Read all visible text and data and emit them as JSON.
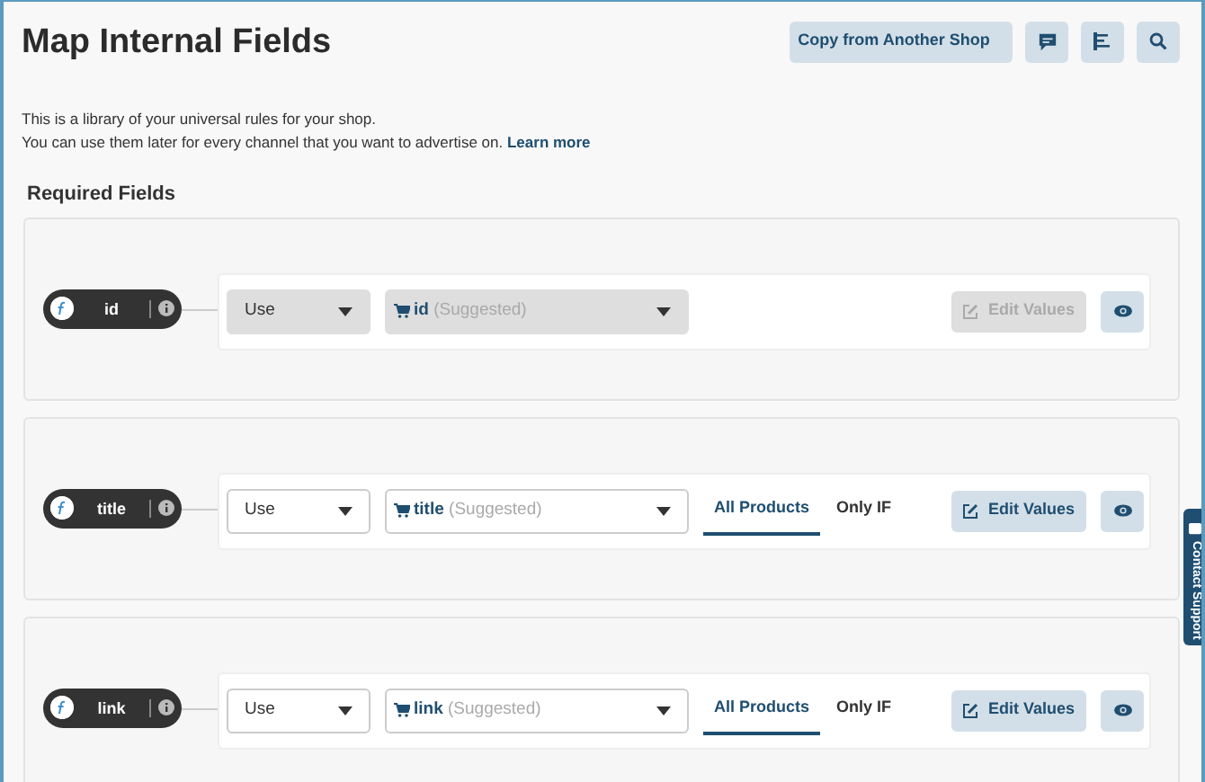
{
  "page": {
    "title": "Map Internal Fields"
  },
  "toolbar": {
    "copy_button": "Copy from Another Shop"
  },
  "intro": {
    "line_1": "This is a library of your universal rules for your shop.",
    "line_2": "You can use them later for every channel that you want to advertise on.",
    "link": "Learn more"
  },
  "section": {
    "title": "Required Fields"
  },
  "fields": [
    {
      "name": "id",
      "disabled": true,
      "mode": "Use",
      "source": "id",
      "source_hint": "(Suggested)",
      "edit_button": "Edit Values"
    },
    {
      "name": "title",
      "disabled": false,
      "mode": "Use",
      "source": "title",
      "source_hint": "(Suggested)",
      "tabs": [
        {
          "label": "All Products",
          "selected": true
        },
        {
          "label": "Only IF",
          "selected": false
        }
      ],
      "edit_button": "Edit Values"
    },
    {
      "name": "link",
      "disabled": false,
      "mode": "Use",
      "source": "link",
      "source_hint": "(Suggested)",
      "tabs": [
        {
          "label": "All Products",
          "selected": true
        },
        {
          "label": "Only IF",
          "selected": false
        }
      ],
      "edit_button": "Edit Values"
    }
  ],
  "contact_support": "Contact Support"
}
